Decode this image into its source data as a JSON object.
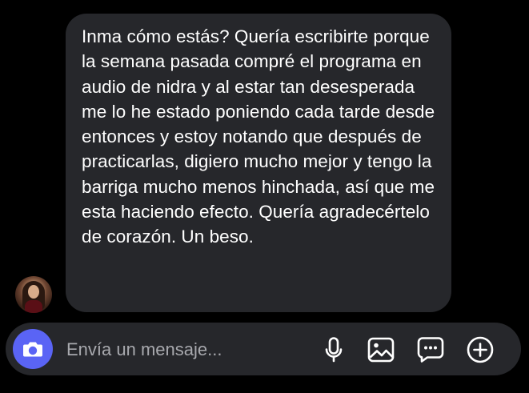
{
  "conversation": {
    "contact": {
      "avatar_icon": "profile-photo"
    },
    "messages": [
      {
        "direction": "incoming",
        "text": "Inma cómo estás? Quería escribirte porque la semana pasada compré el programa en audio de nidra y al estar tan desesperada me lo he estado poniendo cada tarde desde entonces y estoy notando que después de practicarlas, digiero mucho mejor y tengo la barriga mucho menos hinchada, así que me esta haciendo efecto. Quería agradecértelo de corazón. Un beso."
      }
    ]
  },
  "composer": {
    "placeholder": "Envía un mensaje...",
    "value": "",
    "camera_icon": "camera-icon",
    "tools": [
      {
        "name": "microphone",
        "icon": "microphone-icon"
      },
      {
        "name": "gallery",
        "icon": "image-icon"
      },
      {
        "name": "sticker",
        "icon": "sticker-icon"
      },
      {
        "name": "more",
        "icon": "plus-circle-icon"
      }
    ]
  },
  "colors": {
    "background": "#000000",
    "bubble": "#26272b",
    "composer": "#26272b",
    "accent": "#5a64f5",
    "text": "#ffffff",
    "placeholder": "#a8a9ae"
  }
}
